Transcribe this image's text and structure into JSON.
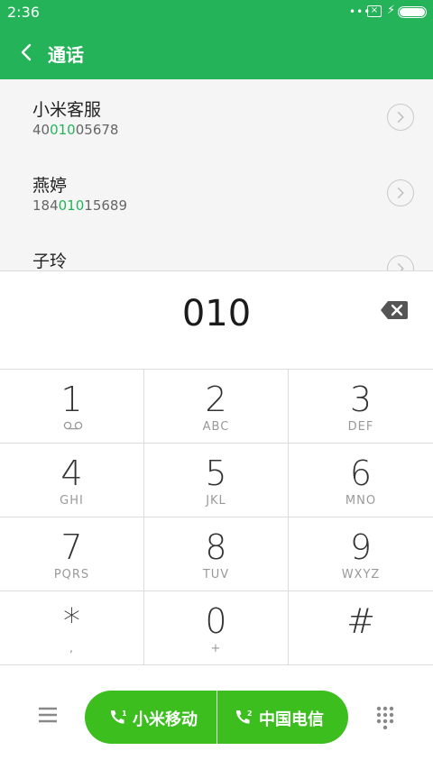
{
  "status_bar": {
    "time": "2:36",
    "dots": "•••",
    "sim_mark": "×",
    "charging": "⚡"
  },
  "header": {
    "title": "通话"
  },
  "contacts": [
    {
      "name": "小米客服",
      "number_pre": "40",
      "number_match": "010",
      "number_post": "05678"
    },
    {
      "name": "燕婷",
      "number_pre": "184",
      "number_match": "010",
      "number_post": "15689"
    },
    {
      "name": "子玲",
      "number_pre": "",
      "number_match": "",
      "number_post": ""
    }
  ],
  "dial_input": {
    "value": "010"
  },
  "keypad": [
    {
      "digit": "1",
      "letters": ""
    },
    {
      "digit": "2",
      "letters": "ABC"
    },
    {
      "digit": "3",
      "letters": "DEF"
    },
    {
      "digit": "4",
      "letters": "GHI"
    },
    {
      "digit": "5",
      "letters": "JKL"
    },
    {
      "digit": "6",
      "letters": "MNO"
    },
    {
      "digit": "7",
      "letters": "PQRS"
    },
    {
      "digit": "8",
      "letters": "TUV"
    },
    {
      "digit": "9",
      "letters": "WXYZ"
    },
    {
      "digit": "*",
      "letters": ","
    },
    {
      "digit": "0",
      "letters": "+"
    },
    {
      "digit": "#",
      "letters": ""
    }
  ],
  "call_buttons": {
    "sim1_label": "小米移动",
    "sim1_badge": "1",
    "sim2_label": "中国电信",
    "sim2_badge": "2"
  },
  "colors": {
    "brand": "#25b35a",
    "call": "#3cbe1f",
    "highlight": "#25b35a"
  }
}
